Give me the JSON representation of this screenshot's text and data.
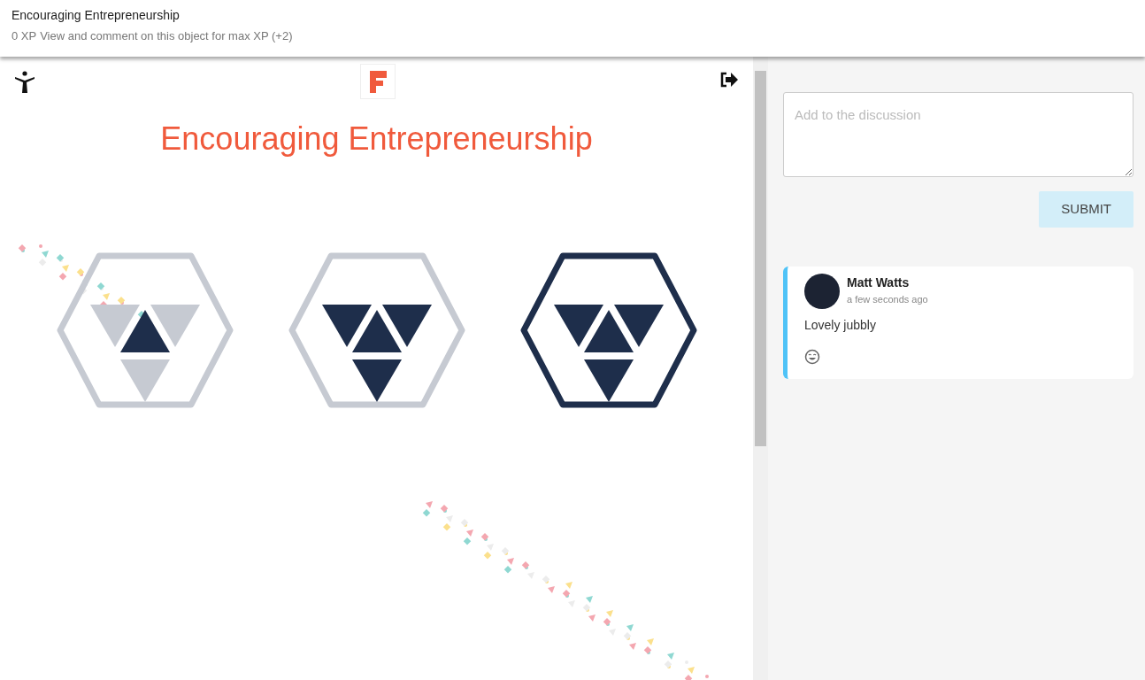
{
  "header": {
    "title": "Encouraging Entrepreneurship",
    "xp": "0 XP",
    "hint": "View and comment on this object for max XP (+2)"
  },
  "content": {
    "title": "Encouraging Entrepreneurship",
    "badges": [
      {
        "complete": false,
        "segments": [
          {
            "filled": false
          },
          {
            "filled": true
          },
          {
            "filled": false
          },
          {
            "filled": false
          }
        ]
      },
      {
        "complete": false,
        "segments": [
          {
            "filled": true
          },
          {
            "filled": true
          },
          {
            "filled": true
          },
          {
            "filled": true
          }
        ]
      },
      {
        "complete": true,
        "segments": [
          {
            "filled": true
          },
          {
            "filled": true
          },
          {
            "filled": true
          },
          {
            "filled": true
          }
        ]
      }
    ]
  },
  "discussion": {
    "placeholder": "Add to the discussion",
    "submit": "SUBMIT",
    "comments": [
      {
        "author": "Matt Watts",
        "time": "a few seconds ago",
        "text": "Lovely jubbly"
      }
    ]
  }
}
